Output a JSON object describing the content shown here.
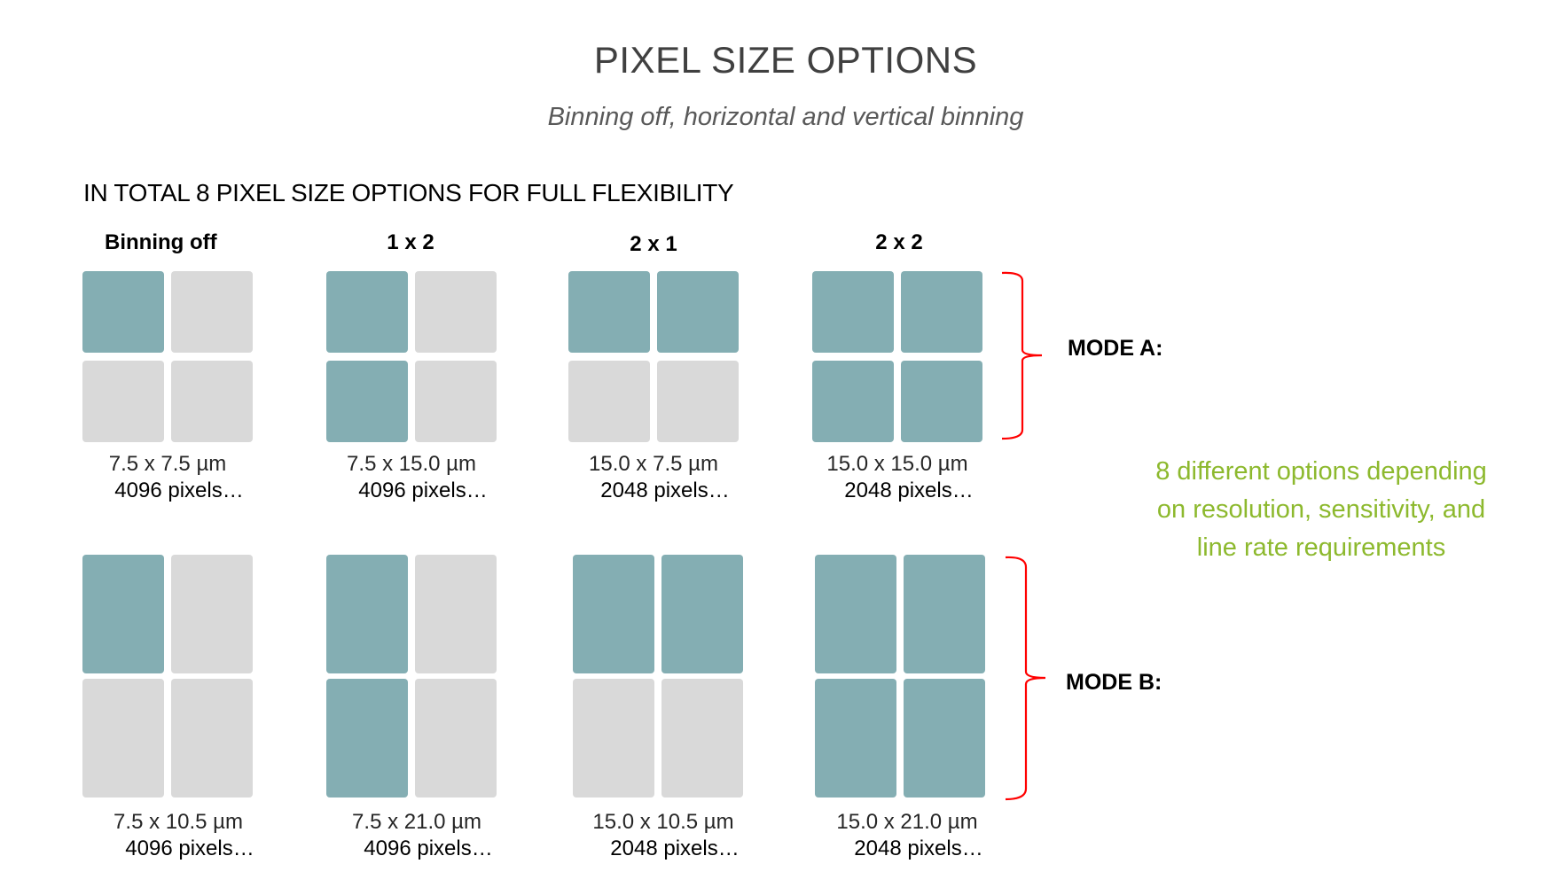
{
  "title": "PIXEL SIZE OPTIONS",
  "subtitle": "Binning off, horizontal and vertical binning",
  "heading": "IN TOTAL 8 PIXEL SIZE OPTIONS FOR FULL FLEXIBILITY",
  "columns": [
    {
      "label": "Binning off"
    },
    {
      "label": "1 x 2"
    },
    {
      "label": "2 x 1"
    },
    {
      "label": "2 x 2"
    }
  ],
  "colors": {
    "active_pixel": "#84aeb3",
    "inactive_pixel": "#d9d9d9",
    "bracket": "#ff0000",
    "note": "#8db92e"
  },
  "modes": [
    {
      "label": "MODE A:",
      "options": [
        {
          "size": "7.5 x 7.5 µm",
          "pixels": "4096 pixels…",
          "active": [
            1,
            0,
            0,
            0
          ]
        },
        {
          "size": "7.5 x 15.0 µm",
          "pixels": "4096 pixels…",
          "active": [
            1,
            0,
            1,
            0
          ]
        },
        {
          "size": "15.0 x 7.5 µm",
          "pixels": "2048 pixels…",
          "active": [
            1,
            1,
            0,
            0
          ]
        },
        {
          "size": "15.0 x 15.0 µm",
          "pixels": "2048 pixels…",
          "active": [
            1,
            1,
            1,
            1
          ]
        }
      ]
    },
    {
      "label": "MODE B:",
      "options": [
        {
          "size": "7.5 x 10.5 µm",
          "pixels": "4096 pixels…",
          "active": [
            1,
            0,
            0,
            0
          ]
        },
        {
          "size": "7.5 x 21.0 µm",
          "pixels": "4096 pixels…",
          "active": [
            1,
            0,
            1,
            0
          ]
        },
        {
          "size": "15.0 x 10.5 µm",
          "pixels": "2048 pixels…",
          "active": [
            1,
            1,
            0,
            0
          ]
        },
        {
          "size": "15.0 x 21.0 µm",
          "pixels": "2048 pixels…",
          "active": [
            1,
            1,
            1,
            1
          ]
        }
      ]
    }
  ],
  "note": "8 different options depending on resolution, sensitivity, and line rate requirements"
}
